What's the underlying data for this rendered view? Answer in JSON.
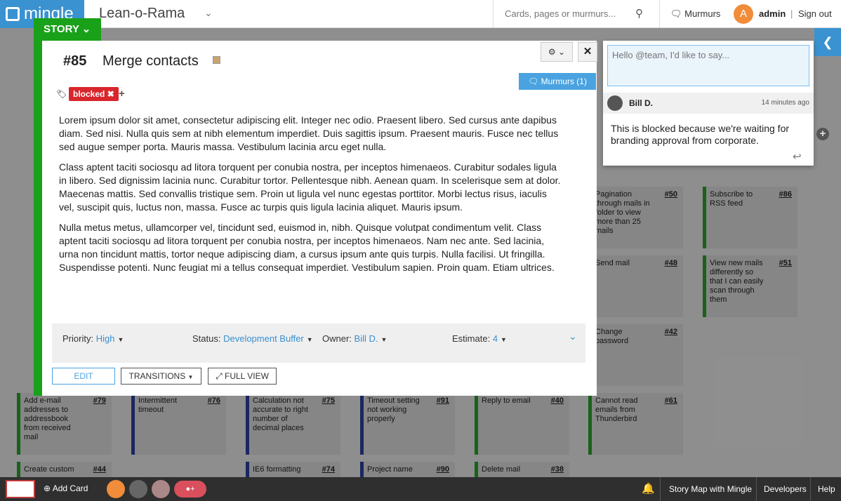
{
  "topbar": {
    "logo": "mingle",
    "project": "Lean-o-Rama",
    "search_placeholder": "Cards, pages or murmurs...",
    "murmurs_label": "Murmurs",
    "avatar_letter": "A",
    "user": "admin",
    "separator": "|",
    "signout": "Sign out"
  },
  "story": {
    "type_label": "STORY",
    "number": "#85",
    "title": "Merge contacts",
    "murmurs_button": "Murmurs (1)",
    "tag": "blocked",
    "description": [
      "Lorem ipsum dolor sit amet, consectetur adipiscing elit. Integer nec odio. Praesent libero. Sed cursus ante dapibus diam. Sed nisi. Nulla quis sem at nibh elementum imperdiet. Duis sagittis ipsum. Praesent mauris. Fusce nec tellus sed augue semper porta. Mauris massa. Vestibulum lacinia arcu eget nulla.",
      "Class aptent taciti sociosqu ad litora torquent per conubia nostra, per inceptos himenaeos. Curabitur sodales ligula in libero. Sed dignissim lacinia nunc. Curabitur tortor. Pellentesque nibh. Aenean quam. In scelerisque sem at dolor. Maecenas mattis. Sed convallis tristique sem. Proin ut ligula vel nunc egestas porttitor. Morbi lectus risus, iaculis vel, suscipit quis, luctus non, massa. Fusce ac turpis quis ligula lacinia aliquet. Mauris ipsum.",
      "Nulla metus metus, ullamcorper vel, tincidunt sed, euismod in, nibh. Quisque volutpat condimentum velit. Class aptent taciti sociosqu ad litora torquent per conubia nostra, per inceptos himenaeos. Nam nec ante. Sed lacinia, urna non tincidunt mattis, tortor neque adipiscing diam, a cursus ipsum ante quis turpis. Nulla facilisi. Ut fringilla. Suspendisse potenti. Nunc feugiat mi a tellus consequat imperdiet. Vestibulum sapien. Proin quam. Etiam ultrices."
    ],
    "properties": {
      "priority_label": "Priority:",
      "priority": "High",
      "status_label": "Status:",
      "status": "Development Buffer",
      "owner_label": "Owner:",
      "owner": "Bill D.",
      "estimate_label": "Estimate:",
      "estimate": "4"
    },
    "buttons": {
      "edit": "EDIT",
      "transitions": "TRANSITIONS",
      "full_view": "FULL VIEW"
    }
  },
  "murmur": {
    "placeholder": "Hello @team, I'd like to say...",
    "author": "Bill D.",
    "time": "14 minutes ago",
    "text": "This is blocked because we're waiting for branding approval from corporate."
  },
  "cards": [
    {
      "num": "#50",
      "text": "Pagination through mails in folder to view more than 25 mails"
    },
    {
      "num": "#86",
      "text": "Subscribe to RSS feed"
    },
    {
      "num": "#48",
      "text": "Send mail"
    },
    {
      "num": "#51",
      "text": "View new mails differently so that I can easily scan through them"
    },
    {
      "num": "#42",
      "text": "Change password"
    },
    {
      "num": "#79",
      "text": "Add e-mail addresses to addressbook from received mail"
    },
    {
      "num": "#76",
      "text": "Intermittent timeout"
    },
    {
      "num": "#75",
      "text": "Calculation not accurate to right number of decimal places"
    },
    {
      "num": "#91",
      "text": "Timeout setting not working properly"
    },
    {
      "num": "#40",
      "text": "Reply to email"
    },
    {
      "num": "#61",
      "text": "Cannot read emails from Thunderbird"
    },
    {
      "num": "#44",
      "text": "Create custom"
    },
    {
      "num": "#74",
      "text": "IE6 formatting"
    },
    {
      "num": "#90",
      "text": "Project name"
    },
    {
      "num": "#38",
      "text": "Delete mail"
    }
  ],
  "bottombar": {
    "add_card": "Add Card",
    "team_button": "+",
    "story_map": "Story Map with Mingle",
    "developers": "Developers",
    "help": "Help"
  }
}
